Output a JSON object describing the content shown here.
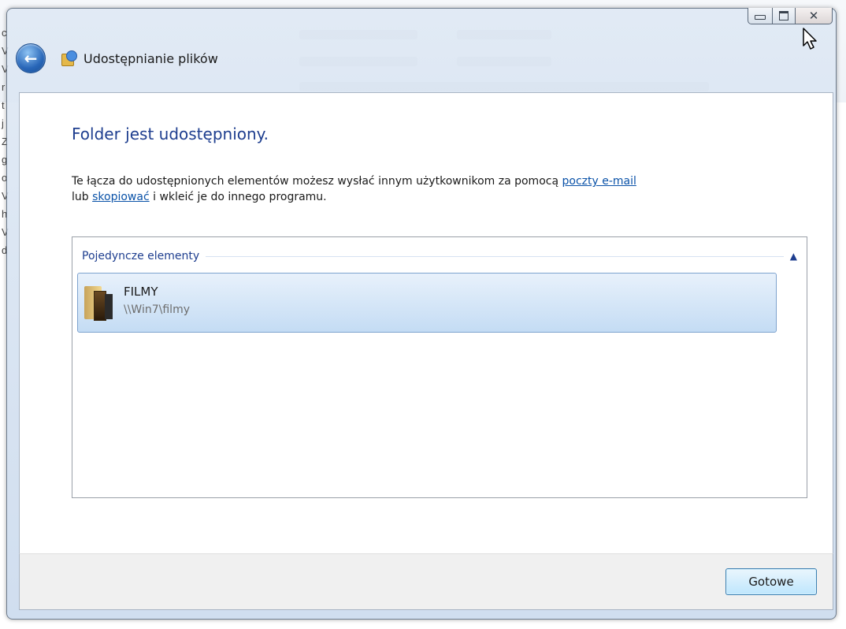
{
  "window": {
    "title": "Udostępnianie plików"
  },
  "heading": "Folder jest udostępniony.",
  "description": {
    "text_before": "Te łącza do udostępnionych elementów możesz wysłać innym użytkownikom za pomocą ",
    "link_email": "poczty e-mail",
    "text_middle": "lub ",
    "link_copy": "skopiować",
    "text_after": " i wkleić je do innego programu."
  },
  "group": {
    "title": "Pojedyncze elementy",
    "items": [
      {
        "name": "FILMY",
        "path": "\\\\Win7\\filmy"
      }
    ]
  },
  "footer": {
    "done_label": "Gotowe"
  },
  "icons": {
    "back": "back-arrow-icon",
    "app": "file-sharing-icon",
    "folder": "folder-icon",
    "collapse": "chevron-up-icon"
  }
}
